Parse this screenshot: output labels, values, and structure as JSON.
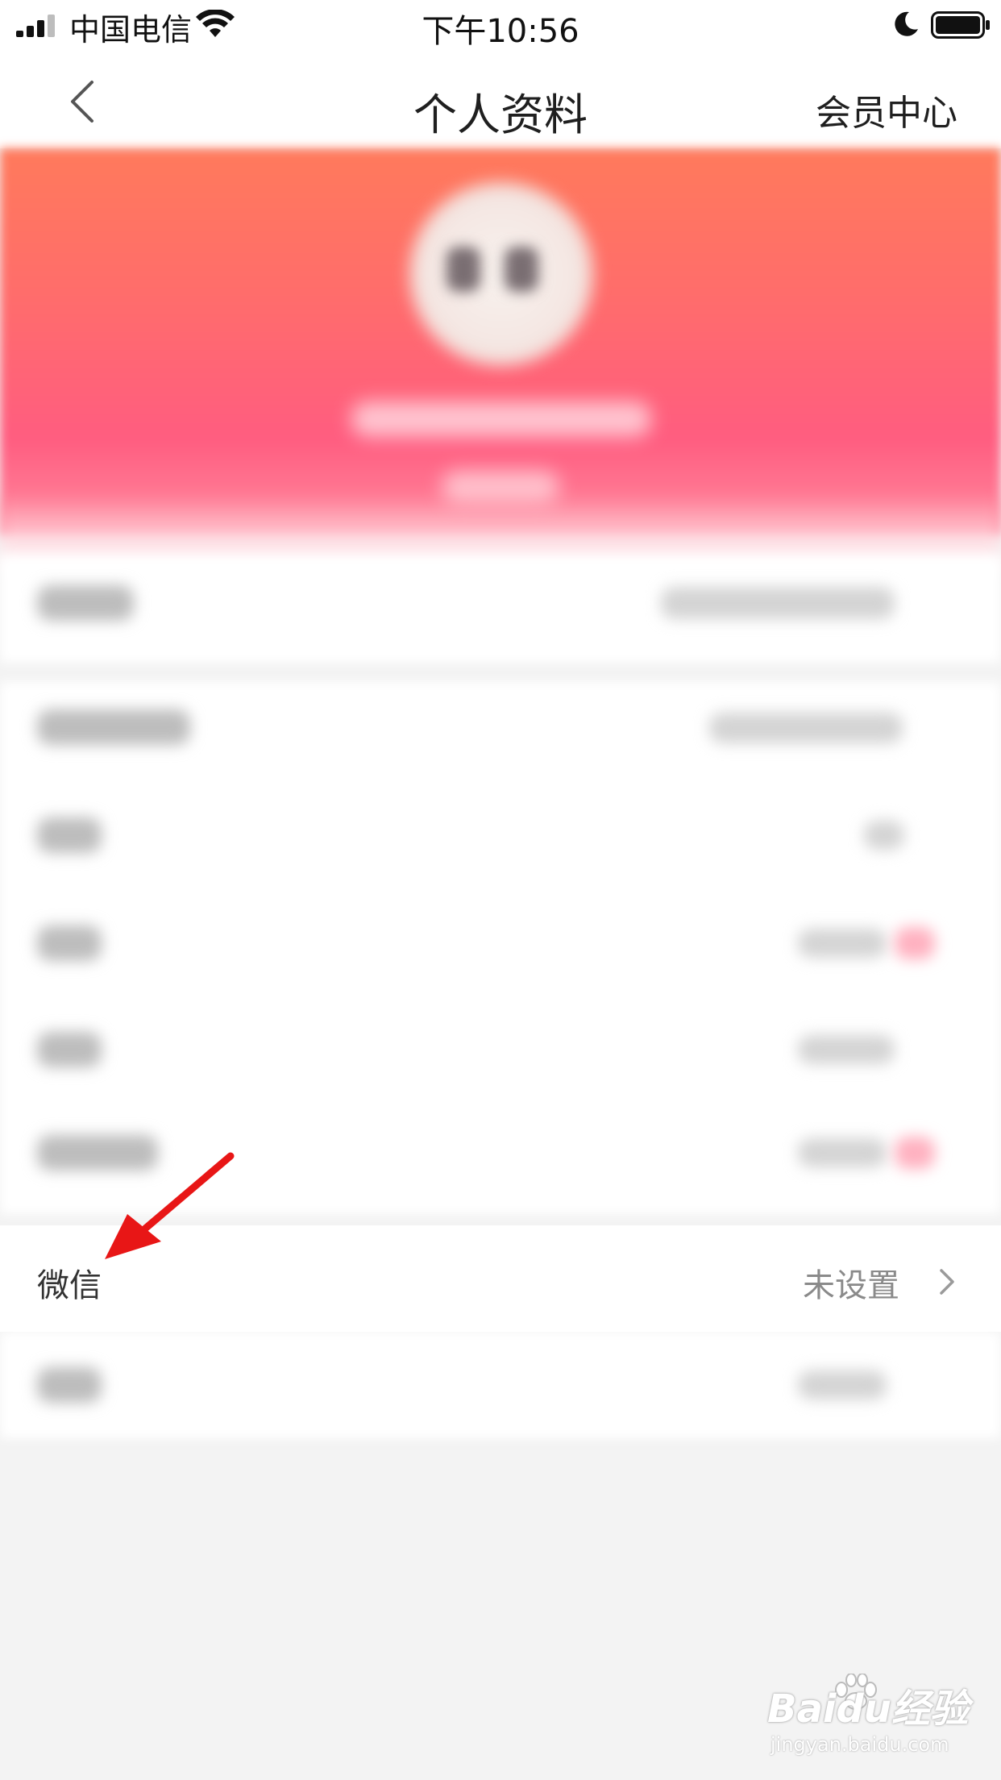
{
  "status_bar": {
    "carrier": "中国电信",
    "time": "下午10:56"
  },
  "nav": {
    "title": "个人资料",
    "right_label": "会员中心",
    "back_icon": "chevron-left-icon"
  },
  "wechat": {
    "label": "微信",
    "value": "未设置",
    "chevron_icon": "chevron-right-icon"
  },
  "annotation": {
    "arrow_color": "#e81616"
  },
  "watermark": {
    "brand": "Baidu经验",
    "url": "jingyan.baidu.com"
  },
  "colors": {
    "header_top": "#ff7a5c",
    "header_bottom": "#ff5d80",
    "page_bg": "#f3f3f3"
  }
}
